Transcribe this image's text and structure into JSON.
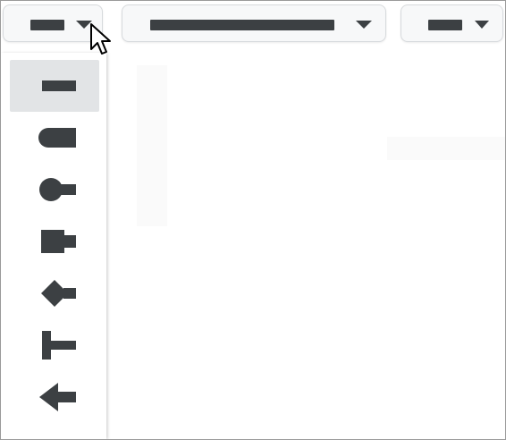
{
  "toolbar": {
    "line_end_start_button": {
      "icon": "line-end-flat-icon",
      "caret": "chevron-down-icon"
    },
    "line_dash_button": {
      "icon": "line-solid-icon",
      "caret": "chevron-down-icon"
    },
    "line_end_end_button": {
      "icon": "line-end-flat-icon",
      "caret": "chevron-down-icon"
    }
  },
  "line_end_menu": {
    "options": [
      {
        "name": "none",
        "icon": "line-end-none-icon",
        "selected": true
      },
      {
        "name": "round-end",
        "icon": "line-end-round-icon",
        "selected": false
      },
      {
        "name": "circle",
        "icon": "line-end-circle-icon",
        "selected": false
      },
      {
        "name": "square",
        "icon": "line-end-square-icon",
        "selected": false
      },
      {
        "name": "diamond",
        "icon": "line-end-diamond-icon",
        "selected": false
      },
      {
        "name": "flat-bar",
        "icon": "line-end-bar-icon",
        "selected": false
      },
      {
        "name": "arrow",
        "icon": "line-end-arrow-icon",
        "selected": false
      }
    ]
  },
  "colors": {
    "icon": "#3c4043",
    "selected_bg": "#e2e4e6",
    "button_bg": "#f7f8f9",
    "border": "#d7dadd"
  }
}
